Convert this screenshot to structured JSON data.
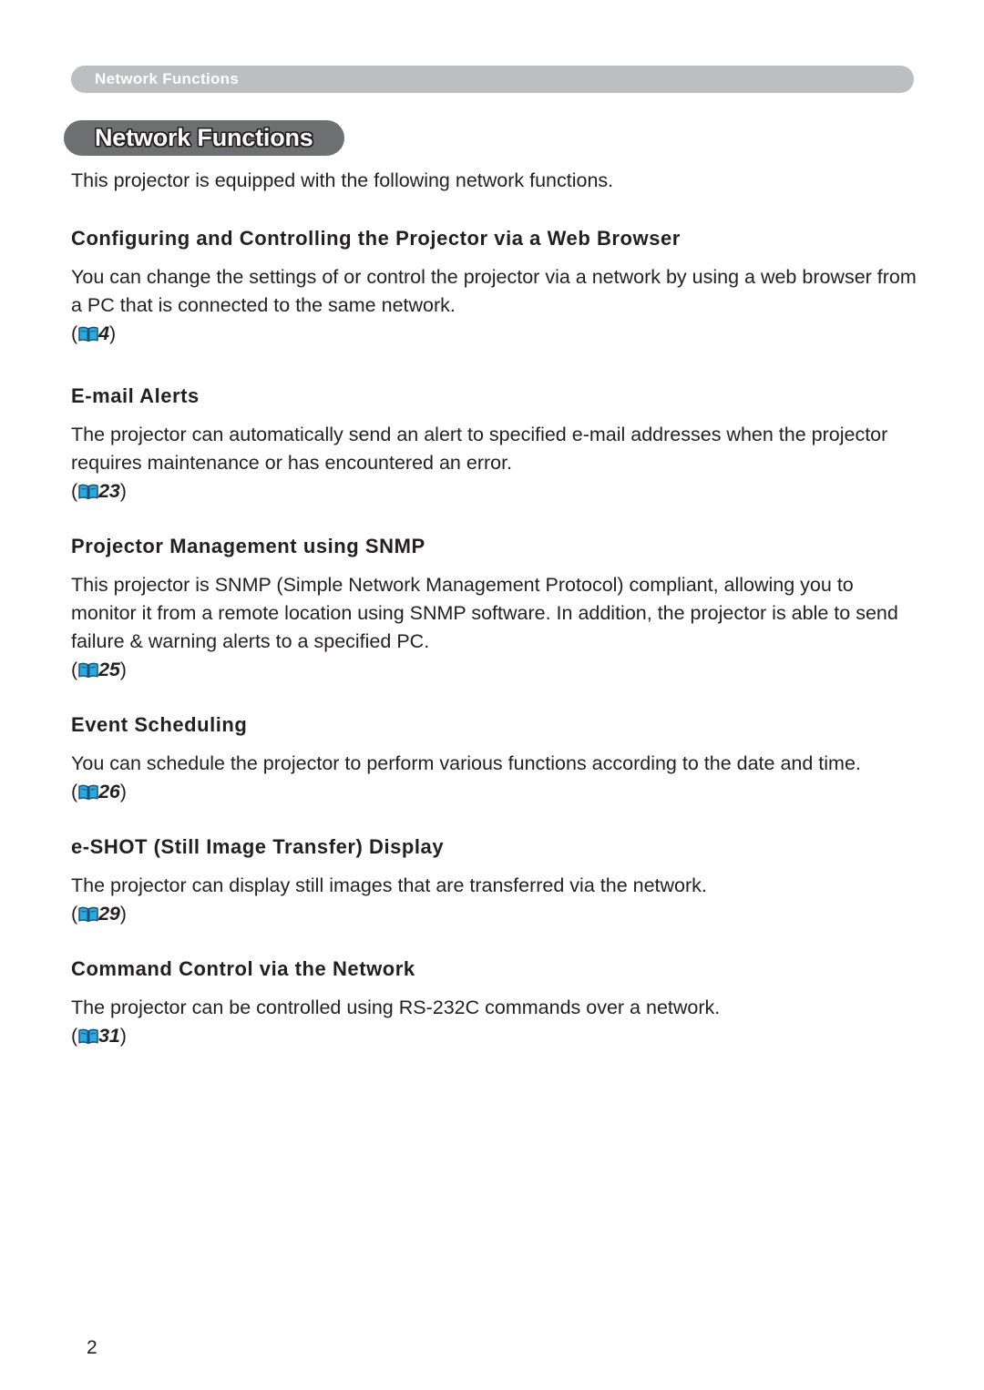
{
  "running_header": {
    "label": "Network Functions"
  },
  "chapter": {
    "title": "Network Functions",
    "intro": "This projector is equipped with the following network functions."
  },
  "colors": {
    "running_header_bg": "#bcbec0",
    "chapter_badge_bg": "#6e6f71",
    "text": "#231f20",
    "book_icon_fill": "#29abe2",
    "book_icon_stroke": "#1b4f72"
  },
  "icons": {
    "page_reference": "open-book-icon"
  },
  "sections": [
    {
      "heading": "Configuring and Controlling the Projector via a Web Browser",
      "body": "You can change the settings of or control the projector via a network by using a web browser from a PC that is connected to the same network.",
      "ref_open": "(",
      "ref_page": "4",
      "ref_close": ")"
    },
    {
      "heading": "E-mail Alerts",
      "body": "The projector can automatically send an alert to specified e-mail addresses when the projector requires maintenance or has encountered an error.",
      "ref_open": "(",
      "ref_page": "23",
      "ref_close": ")"
    },
    {
      "heading": "Projector Management using SNMP",
      "body": "This projector is SNMP (Simple Network Management Protocol) compliant, allowing you to monitor it from a remote location using SNMP software. In addition, the projector is able to send failure & warning alerts to a specified PC.",
      "ref_open": "(",
      "ref_page": "25",
      "ref_close": ")"
    },
    {
      "heading": "Event Scheduling",
      "body": "You can schedule the projector to perform various functions according to the date and time.",
      "ref_open": "(",
      "ref_page": "26",
      "ref_close": ")"
    },
    {
      "heading": "e-SHOT (Still Image Transfer) Display",
      "body": "The projector can display still images that are transferred via the network.",
      "ref_open": "(",
      "ref_page": "29",
      "ref_close": ")"
    },
    {
      "heading": "Command Control via the Network",
      "body": "The projector can be controlled using RS-232C commands over a network.",
      "ref_open": "(",
      "ref_page": "31",
      "ref_close": ")"
    }
  ],
  "folio": {
    "page_number": "2"
  }
}
